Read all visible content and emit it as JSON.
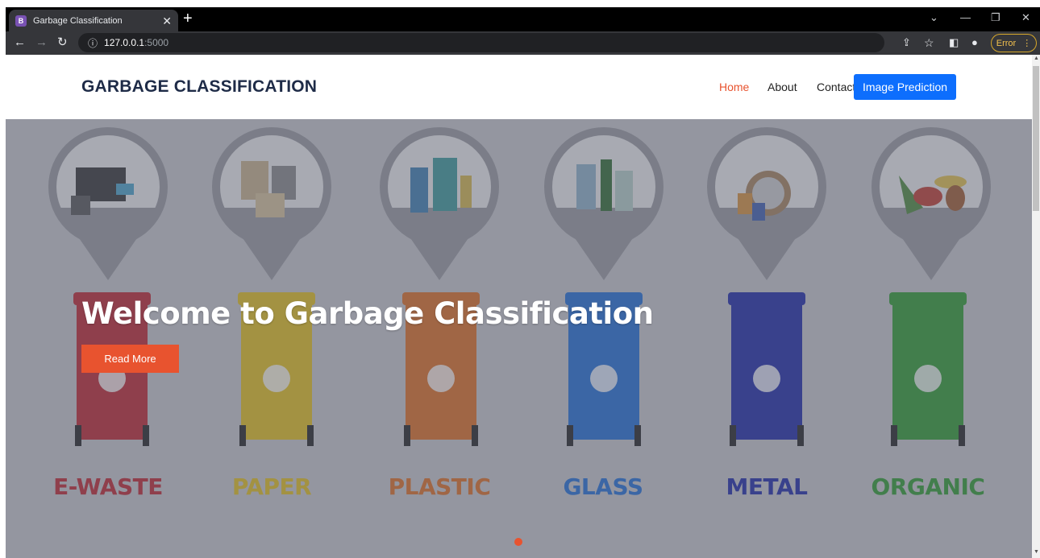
{
  "browser": {
    "tab_title": "Garbage Classification",
    "tab_favicon": "B",
    "url_host": "127.0.0.1",
    "url_port": ":5000",
    "error_label": "Error"
  },
  "navbar": {
    "brand": "GARBAGE CLASSIFICATION",
    "links": [
      {
        "label": "Home",
        "active": true
      },
      {
        "label": "About",
        "active": false
      },
      {
        "label": "Contact",
        "active": false
      }
    ],
    "cta": "Image Prediction"
  },
  "hero": {
    "headline": "Welcome to Garbage Classification",
    "button": "Read More",
    "categories": [
      {
        "label": "E-WASTE",
        "color": "#c0242c"
      },
      {
        "label": "PAPER",
        "color": "#e6c11a"
      },
      {
        "label": "PLASTIC",
        "color": "#e06d1f"
      },
      {
        "label": "GLASS",
        "color": "#1f6ed6"
      },
      {
        "label": "METAL",
        "color": "#1b27a8"
      },
      {
        "label": "ORGANIC",
        "color": "#2c9c2c"
      }
    ],
    "carousel": {
      "slides": 1,
      "active": 1
    }
  },
  "colors": {
    "accent": "#e8532f",
    "primary": "#0d6efd",
    "brand_text": "#1e2b47"
  }
}
